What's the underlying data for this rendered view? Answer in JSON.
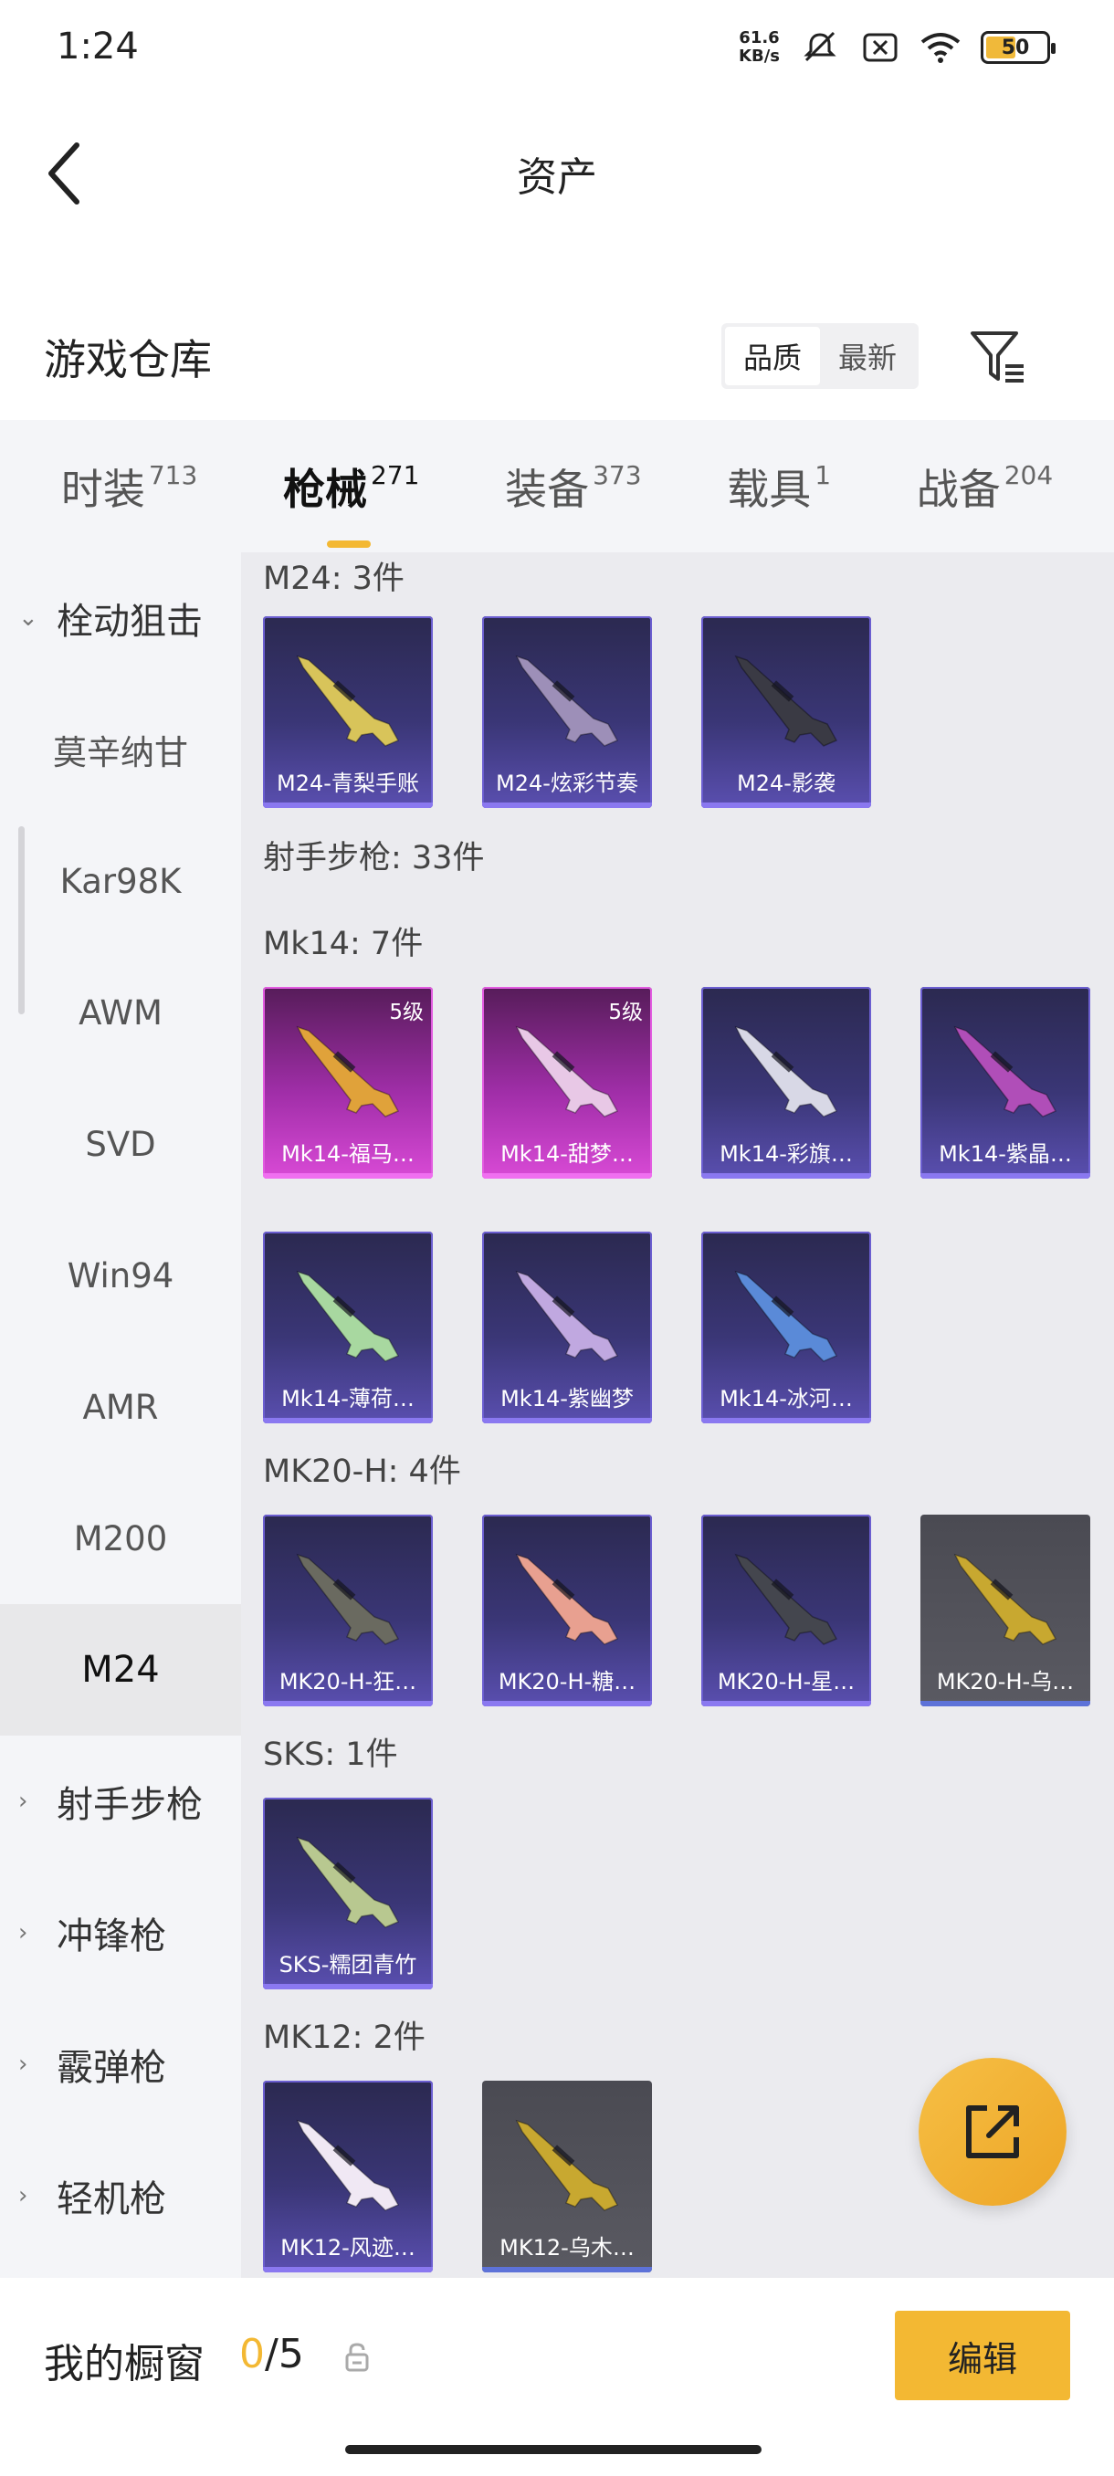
{
  "status_bar": {
    "time": "1:24",
    "net_speed_value": "61.6",
    "net_speed_unit": "KB/s",
    "battery": "50"
  },
  "header": {
    "title": "资产"
  },
  "warehouse": {
    "title": "游戏仓库",
    "sort_options": [
      "品质",
      "最新"
    ]
  },
  "tabs": [
    {
      "label": "时装",
      "count": "713"
    },
    {
      "label": "枪械",
      "count": "271"
    },
    {
      "label": "装备",
      "count": "373"
    },
    {
      "label": "载具",
      "count": "1"
    },
    {
      "label": "战备",
      "count": "204"
    }
  ],
  "sidebar": {
    "items": [
      {
        "label": "栓动狙击",
        "chevron": "⌄"
      },
      {
        "label": "莫辛纳甘"
      },
      {
        "label": "Kar98K"
      },
      {
        "label": "AWM"
      },
      {
        "label": "SVD"
      },
      {
        "label": "Win94"
      },
      {
        "label": "AMR"
      },
      {
        "label": "M200"
      },
      {
        "label": "M24"
      },
      {
        "label": "射手步枪",
        "chevron": "›"
      },
      {
        "label": "冲锋枪",
        "chevron": "›"
      },
      {
        "label": "霰弹枪",
        "chevron": "›"
      },
      {
        "label": "轻机枪",
        "chevron": "›"
      }
    ]
  },
  "content": {
    "sections": [
      {
        "label": "M24: 3件"
      },
      {
        "label": "射手步枪: 33件"
      },
      {
        "label": "Mk14: 7件"
      },
      {
        "label": "MK20-H: 4件"
      },
      {
        "label": "SKS: 1件"
      },
      {
        "label": "MK12: 2件"
      }
    ],
    "cards": [
      {
        "name": "M24-青梨手账",
        "gun_color": "#d8c45a",
        "quality": "purple"
      },
      {
        "name": "M24-炫彩节奏",
        "gun_color": "#9d8fb8",
        "quality": "purple"
      },
      {
        "name": "M24-影袭",
        "gun_color": "#3a3a44",
        "quality": "purple"
      },
      {
        "name": "Mk14-福马…",
        "level": "5级",
        "gun_color": "#e0a23a",
        "quality": "pink"
      },
      {
        "name": "Mk14-甜梦…",
        "level": "5级",
        "gun_color": "#e8c8e6",
        "quality": "pink"
      },
      {
        "name": "Mk14-彩旗…",
        "gun_color": "#d8d8e6",
        "quality": "purple"
      },
      {
        "name": "Mk14-紫晶…",
        "gun_color": "#b04eb8",
        "quality": "purple"
      },
      {
        "name": "Mk14-薄荷…",
        "gun_color": "#a8d8a0",
        "quality": "purple"
      },
      {
        "name": "Mk14-紫幽梦",
        "gun_color": "#c0a8e0",
        "quality": "purple"
      },
      {
        "name": "Mk14-冰河…",
        "gun_color": "#5a8ad8",
        "quality": "purple"
      },
      {
        "name": "MK20-H-狂…",
        "gun_color": "#6a6a60",
        "quality": "purple"
      },
      {
        "name": "MK20-H-糖…",
        "gun_color": "#e8a090",
        "quality": "purple"
      },
      {
        "name": "MK20-H-星…",
        "gun_color": "#44464e",
        "quality": "purple"
      },
      {
        "name": "MK20-H-乌…",
        "gun_color": "#c8a830",
        "quality": "gray"
      },
      {
        "name": "SKS-糯团青竹",
        "gun_color": "#b8c890",
        "quality": "purple"
      },
      {
        "name": "MK12-风迹…",
        "gun_color": "#f0e8f4",
        "quality": "purple"
      },
      {
        "name": "MK12-乌木…",
        "gun_color": "#c8a830",
        "quality": "gray"
      }
    ]
  },
  "bottom_bar": {
    "label": "我的橱窗",
    "current": "0",
    "total": "/5",
    "edit_label": "编辑"
  },
  "icons": {
    "back": "back-arrow-icon",
    "filter": "filter-icon",
    "share": "share-icon",
    "lock": "lock-icon"
  },
  "colors": {
    "accent": "#f3b833",
    "purple_quality": "#5a4fb0",
    "pink_quality": "#d94ad6",
    "gray_quality": "#5a5a62"
  }
}
